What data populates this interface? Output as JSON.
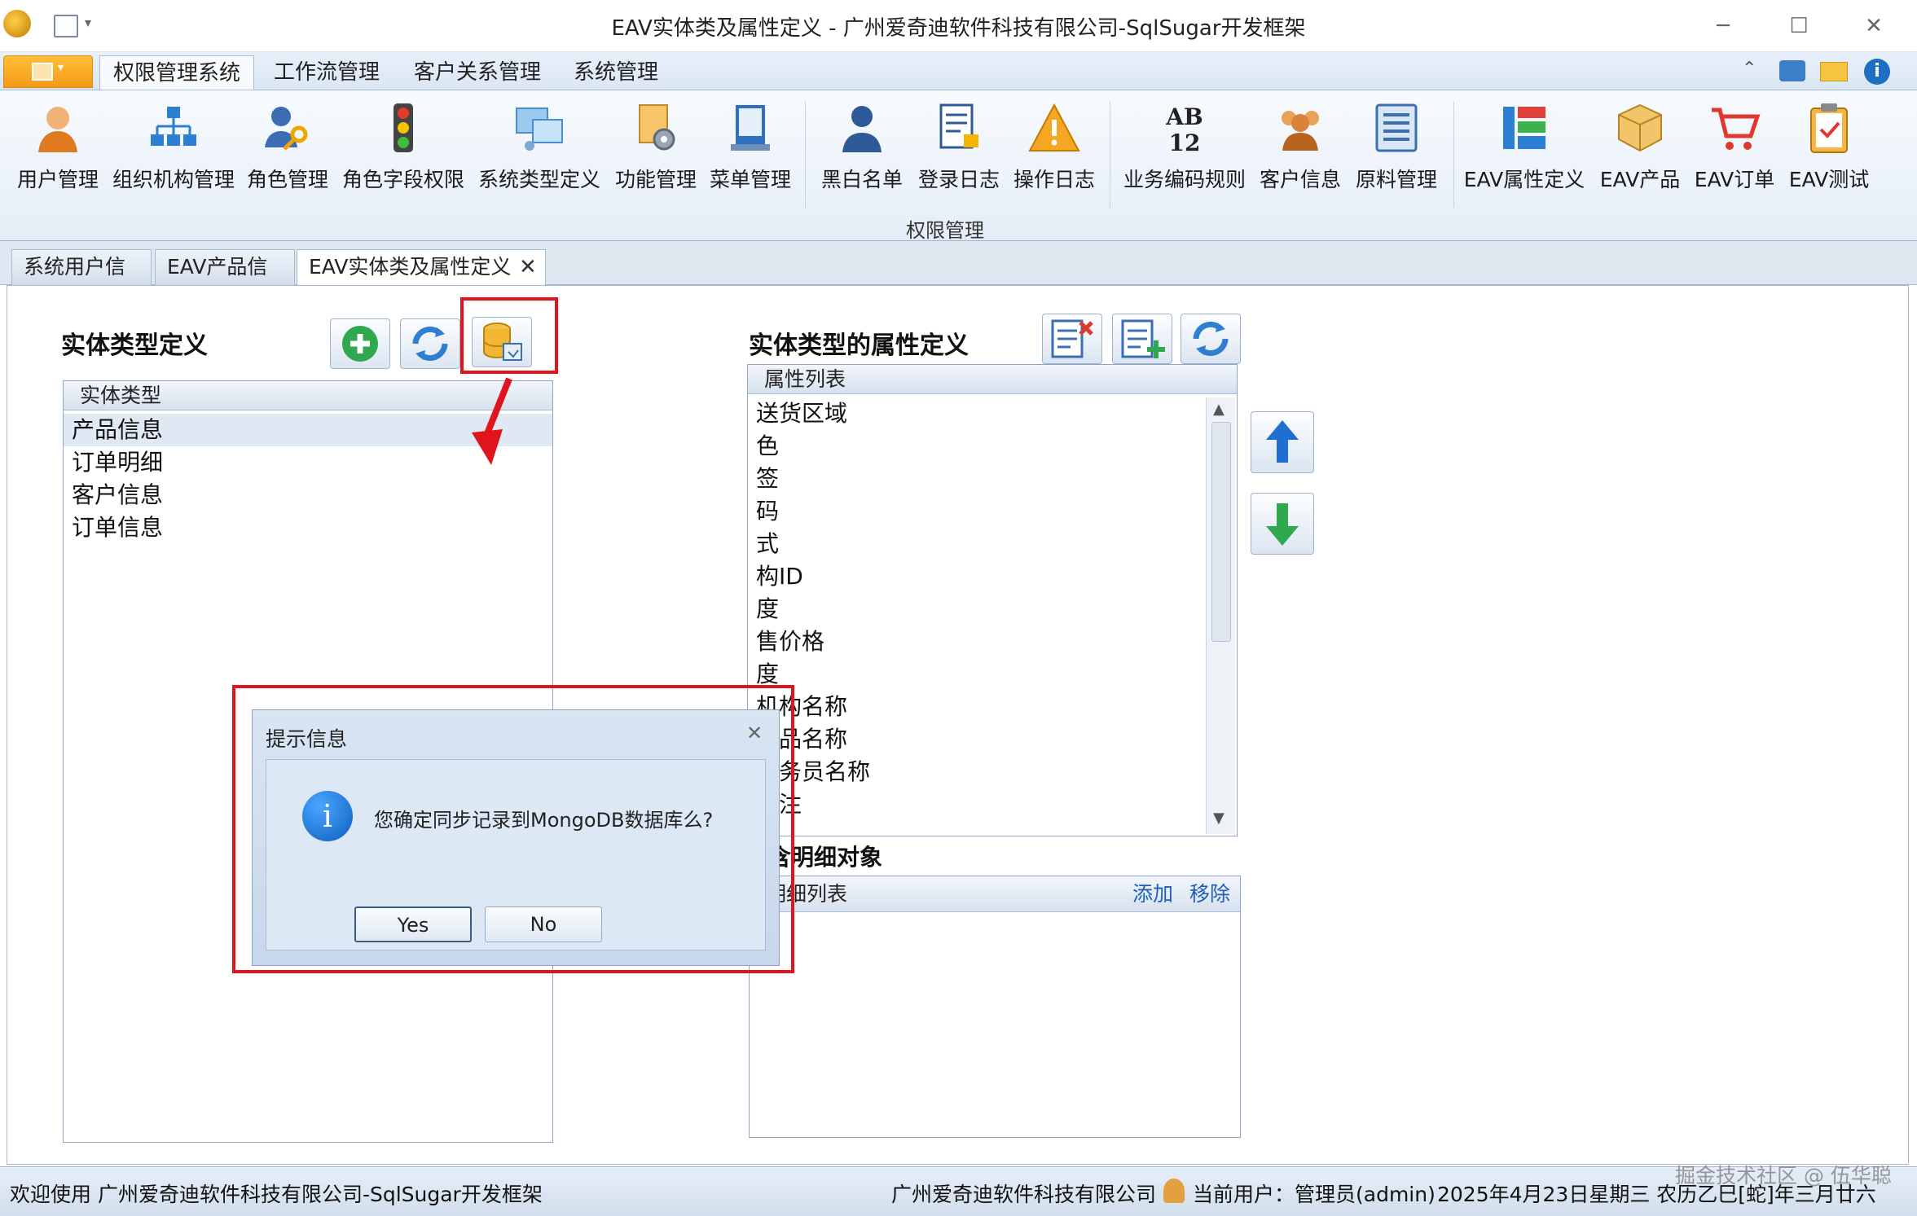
{
  "window": {
    "title": "EAV实体类及属性定义 - 广州爱奇迪软件科技有限公司-SqlSugar开发框架"
  },
  "menu": {
    "tabs": [
      "权限管理系统",
      "工作流管理",
      "客户关系管理",
      "系统管理"
    ],
    "active": "权限管理系统"
  },
  "ribbon": {
    "group_label": "权限管理",
    "buttons": [
      {
        "label": "用户管理",
        "icon": "user-icon"
      },
      {
        "label": "组织机构管理",
        "icon": "org-chart-icon"
      },
      {
        "label": "角色管理",
        "icon": "role-key-icon"
      },
      {
        "label": "角色字段权限",
        "icon": "traffic-light-icon"
      },
      {
        "label": "系统类型定义",
        "icon": "system-type-icon"
      },
      {
        "label": "功能管理",
        "icon": "function-gear-icon"
      },
      {
        "label": "菜单管理",
        "icon": "menu-book-icon"
      },
      {
        "label": "黑白名单",
        "icon": "person-icon"
      },
      {
        "label": "登录日志",
        "icon": "login-log-icon"
      },
      {
        "label": "操作日志",
        "icon": "warning-icon"
      },
      {
        "label": "业务编码规则",
        "icon": "ab12-icon"
      },
      {
        "label": "客户信息",
        "icon": "customers-icon"
      },
      {
        "label": "原料管理",
        "icon": "material-list-icon"
      },
      {
        "label": "EAV属性定义",
        "icon": "attribute-grid-icon"
      },
      {
        "label": "EAV产品",
        "icon": "product-box-icon"
      },
      {
        "label": "EAV订单",
        "icon": "cart-icon"
      },
      {
        "label": "EAV测试",
        "icon": "clipboard-check-icon"
      }
    ]
  },
  "doc_tabs": [
    "系统用户信息",
    "EAV产品信息",
    "EAV实体类及属性定义"
  ],
  "left": {
    "title": "实体类型定义",
    "list_header": "实体类型",
    "items": [
      "产品信息",
      "订单明细",
      "客户信息",
      "订单信息"
    ]
  },
  "right": {
    "title": "实体类型的属性定义",
    "list_header": "属性列表",
    "items": [
      "送货区域",
      "色",
      "签",
      "码",
      "式",
      "构ID",
      "度",
      "售价格",
      "度",
      "机构名称",
      "产品名称",
      "业务员名称",
      "备注"
    ],
    "detail_title": "包含明细对象",
    "detail_header": "明细列表",
    "detail_add": "添加",
    "detail_remove": "移除"
  },
  "arrow_text": "------>",
  "dialog": {
    "title": "提示信息",
    "message": "您确定同步记录到MongoDB数据库么?",
    "yes": "Yes",
    "no": "No"
  },
  "status": {
    "welcome": "欢迎使用 广州爱奇迪软件科技有限公司-SqlSugar开发框架",
    "company": "广州爱奇迪软件科技有限公司",
    "user": "当前用户：管理员(admin)",
    "date": "2025年4月23日星期三 农历乙巳[蛇]年三月廿六"
  },
  "watermark": "掘金技术社区 @ 伍华聪",
  "colors": {
    "highlight_red": "#e0141c",
    "ribbon_bg": "#e4edf7",
    "app_menu": "#f39a16"
  }
}
